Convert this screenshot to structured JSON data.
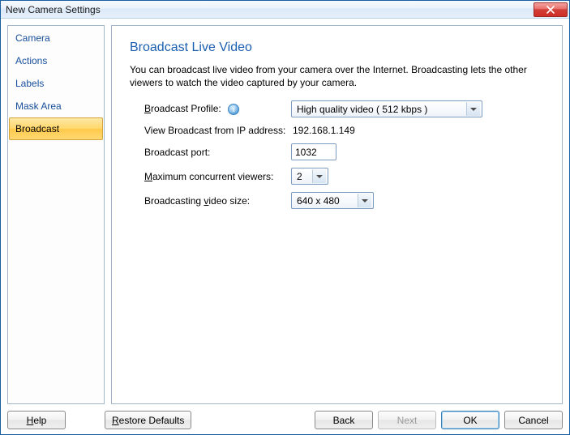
{
  "window": {
    "title": "New Camera Settings"
  },
  "sidebar": {
    "items": [
      {
        "label": "Camera"
      },
      {
        "label": "Actions"
      },
      {
        "label": "Labels"
      },
      {
        "label": "Mask Area"
      },
      {
        "label": "Broadcast",
        "selected": true
      }
    ]
  },
  "page": {
    "title": "Broadcast Live Video",
    "description": "You can broadcast live video from your camera over the Internet. Broadcasting lets the other viewers to watch the video captured by your camera."
  },
  "form": {
    "profile_label_pre": "B",
    "profile_label_post": "roadcast Profile:",
    "profile_value": "High quality video ( 512 kbps )",
    "ip_label": "View Broadcast from IP address:",
    "ip_value": "192.168.1.149",
    "port_label": "Broadcast port:",
    "port_value": "1032",
    "viewers_label_pre": "M",
    "viewers_label_post": "aximum concurrent viewers:",
    "viewers_value": "2",
    "size_label_pre": "Broadcasting ",
    "size_label_ul": "v",
    "size_label_post": "ideo size:",
    "size_value": "640 x 480"
  },
  "buttons": {
    "help_ul": "H",
    "help_post": "elp",
    "restore_ul": "R",
    "restore_post": "estore Defaults",
    "back": "Back",
    "next": "Next",
    "ok": "OK",
    "cancel": "Cancel"
  }
}
